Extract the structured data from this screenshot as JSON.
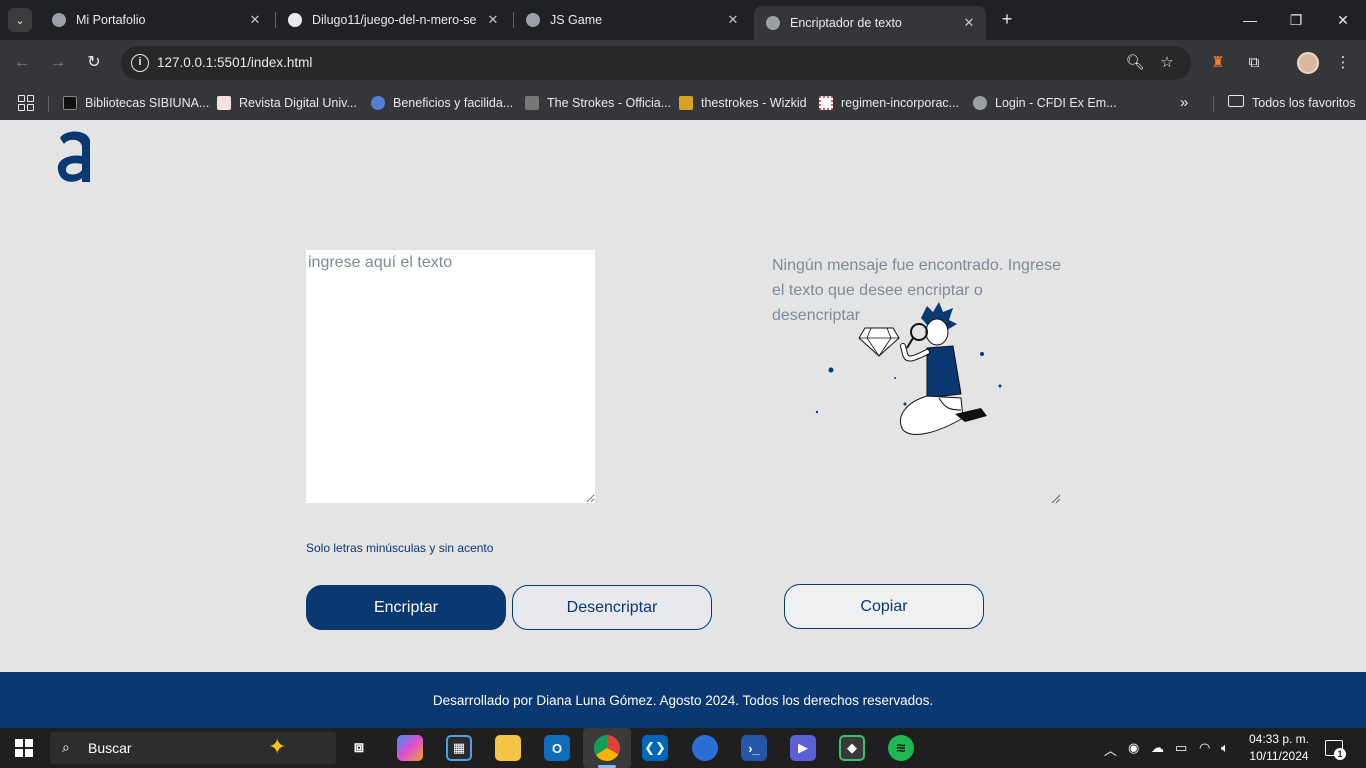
{
  "browser": {
    "tabs": [
      {
        "title": "Mi Portafolio",
        "favicon": "globe-icon",
        "active": false
      },
      {
        "title": "Dilugo11/juego-del-n-mero-se",
        "favicon": "github-icon",
        "active": false
      },
      {
        "title": "JS Game",
        "favicon": "globe-icon",
        "active": false
      },
      {
        "title": "Encriptador de texto",
        "favicon": "globe-icon",
        "active": true
      }
    ],
    "close_glyph": "✕",
    "new_tab_glyph": "+",
    "url": "127.0.0.1:5501/index.html",
    "bookmarks": [
      {
        "label": "Bibliotecas SIBIUNA...",
        "icon_color": "#111111"
      },
      {
        "label": "Revista Digital Univ...",
        "icon_color": "#f2b8b8"
      },
      {
        "label": "Beneficios y facilida...",
        "icon_color": "#4f7fd6"
      },
      {
        "label": "The Strokes - Officia...",
        "icon_color": "#777777"
      },
      {
        "label": "thestrokes - Wizkid",
        "icon_color": "#d6a21f"
      },
      {
        "label": "regimen-incorporac...",
        "icon_color": "#e05a6a"
      },
      {
        "label": "Login - CFDI Ex Em...",
        "icon_color": "#9aa0a6"
      }
    ],
    "bookmarks_more": "»",
    "all_bookmarks": "Todos los favoritos"
  },
  "page": {
    "textarea_placeholder": "ingrese aquí el texto",
    "hint": "Solo letras minúsculas y sin acento",
    "output_message": "Ningún mensaje fue encontrado. Ingrese el texto que desee encriptar o desencriptar",
    "buttons": {
      "encrypt": "Encriptar",
      "decrypt": "Desencriptar",
      "copy": "Copiar"
    },
    "footer": "Desarrollado por Diana Luna Gómez. Agosto 2024. Todos los derechos reservados.",
    "colors": {
      "primary": "#0a3871",
      "background": "#e4e4e5",
      "placeholder": "#7f8a99"
    }
  },
  "taskbar": {
    "search_label": "Buscar",
    "apps": [
      "task-view-icon",
      "copilot-icon",
      "store-icon",
      "file-explorer-icon",
      "outlook-icon",
      "chrome-icon",
      "vscode-icon",
      "firefox-icon",
      "powershell-icon",
      "clipchamp-icon",
      "git-icon",
      "spotify-icon"
    ],
    "time": "04:33 p. m.",
    "date": "10/11/2024",
    "notification_count": "1"
  }
}
